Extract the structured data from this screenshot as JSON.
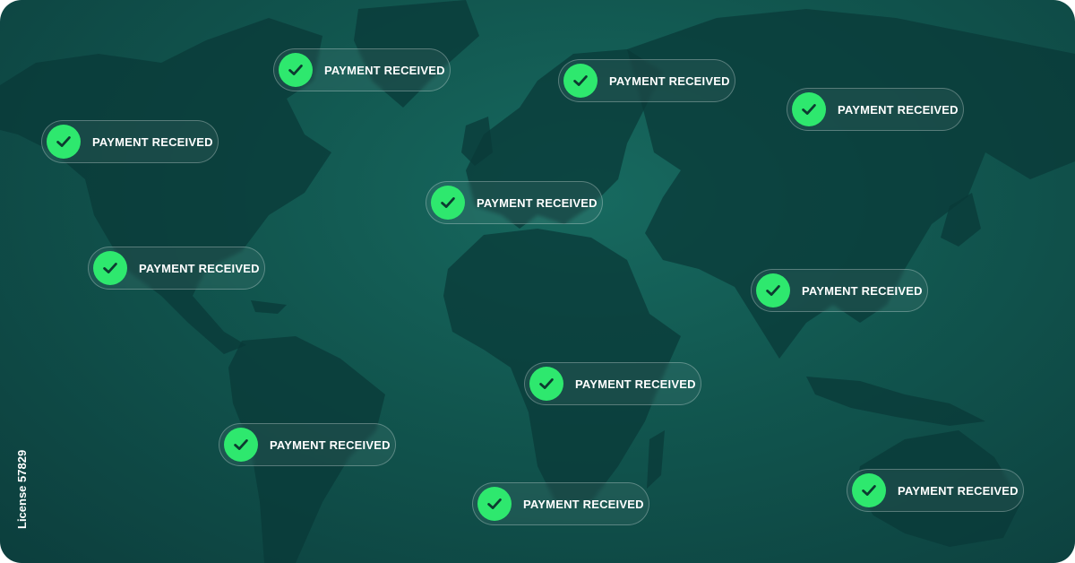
{
  "badges": [
    {
      "label": "PAYMENT RECEIVED",
      "icon": "check-icon"
    },
    {
      "label": "PAYMENT RECEIVED",
      "icon": "check-icon"
    },
    {
      "label": "PAYMENT RECEIVED",
      "icon": "check-icon"
    },
    {
      "label": "PAYMENT RECEIVED",
      "icon": "check-icon"
    },
    {
      "label": "PAYMENT RECEIVED",
      "icon": "check-icon"
    },
    {
      "label": "PAYMENT RECEIVED",
      "icon": "check-icon"
    },
    {
      "label": "PAYMENT RECEIVED",
      "icon": "check-icon"
    },
    {
      "label": "PAYMENT RECEIVED",
      "icon": "check-icon"
    },
    {
      "label": "PAYMENT RECEIVED",
      "icon": "check-icon"
    },
    {
      "label": "PAYMENT RECEIVED",
      "icon": "check-icon"
    },
    {
      "label": "PAYMENT RECEIVED",
      "icon": "check-icon"
    }
  ],
  "license": "License 57829",
  "colors": {
    "background": "#11554e",
    "land": "#0a3a38",
    "check_circle": "#2ee86e",
    "check_mark": "#0c3b30",
    "text": "#ffffff"
  }
}
